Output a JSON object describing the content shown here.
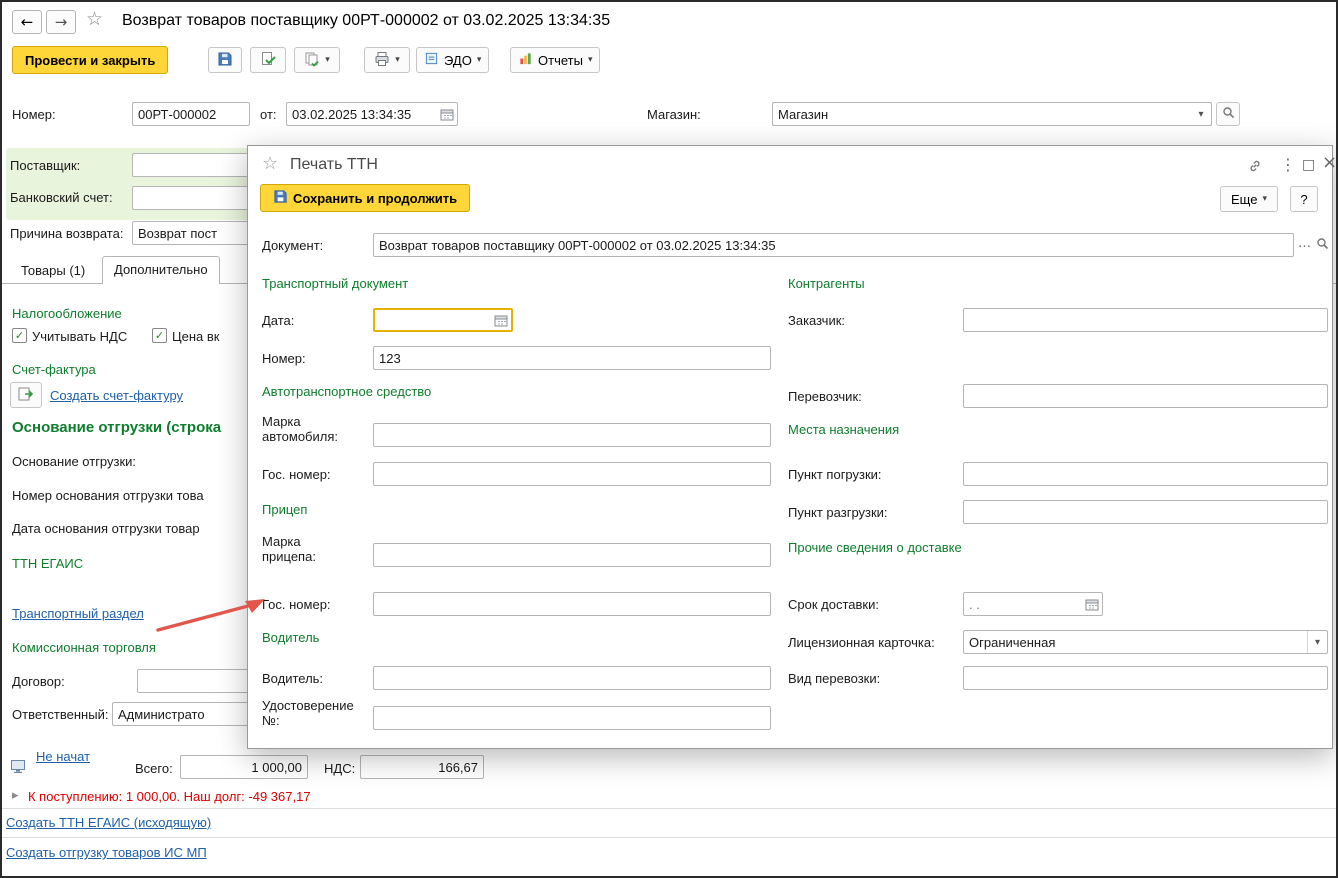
{
  "window": {
    "title": "Возврат товаров поставщику 00РТ-000002 от 03.02.2025 13:34:35",
    "toolbar": {
      "post_and_close": "Провести и закрыть",
      "edo_label": "ЭДО",
      "reports_label": "Отчеты"
    },
    "header_fields": {
      "number_label": "Номер:",
      "number_value": "00РТ-000002",
      "date_label": "от:",
      "date_value": "03.02.2025 13:34:35",
      "store_label": "Магазин:",
      "store_value": "Магазин",
      "supplier_label": "Поставщик:",
      "bank_account_label": "Банковский счет:",
      "reason_label": "Причина возврата:",
      "reason_value": "Возврат пост"
    },
    "tabs": {
      "goods": "Товары (1)",
      "additional": "Дополнительно"
    },
    "additional_tab": {
      "taxation_title": "Налогообложение",
      "vat_checkbox_label": "Учитывать НДС",
      "price_checkbox_label": "Цена вк",
      "invoice_title": "Счет-фактура",
      "create_invoice_link": "Создать счет-фактуру",
      "shipment_basis_heading": "Основание отгрузки (строка",
      "shipment_basis_label": "Основание отгрузки:",
      "shipment_basis_number_label": "Номер основания отгрузки това",
      "shipment_basis_date_label": "Дата основания отгрузки товар",
      "ttn_egais_title": "ТТН ЕГАИС",
      "transport_section_link": "Транспортный раздел",
      "commission_title": "Комиссионная торговля",
      "contract_label": "Договор:",
      "responsible_label": "Ответственный:",
      "responsible_value": "Администрато"
    },
    "footer": {
      "egais_status_link": "Не начат",
      "total_label": "Всего:",
      "total_value": "1 000,00",
      "vat_label": "НДС:",
      "vat_value": "166,67",
      "debt_warning": "К поступлению: 1 000,00. Наш долг: -49 367,17",
      "create_ttn_link": "Создать ТТН ЕГАИС (исходящую)",
      "create_shipment_link": "Создать отгрузку товаров ИС МП"
    }
  },
  "dialog": {
    "title": "Печать ТТН",
    "toolbar": {
      "save_continue": "Сохранить и продолжить",
      "more": "Еще",
      "help": "?"
    },
    "document": {
      "label": "Документ:",
      "value": "Возврат товаров поставщику 00РТ-000002 от 03.02.2025 13:34:35"
    },
    "transport_doc": {
      "title": "Транспортный документ",
      "date_label": "Дата:",
      "date_value": "",
      "number_label": "Номер:",
      "number_value": "123"
    },
    "vehicle": {
      "title": "Автотранспортное средство",
      "brand_label": "Марка автомобиля:",
      "number_label": "Гос. номер:"
    },
    "trailer": {
      "title": "Прицеп",
      "brand_label": "Марка прицепа:",
      "number_label": "Гос. номер:"
    },
    "driver": {
      "title": "Водитель",
      "name_label": "Водитель:",
      "license_label": "Удостоверение №:"
    },
    "counterparties": {
      "title": "Контрагенты",
      "customer_label": "Заказчик:",
      "carrier_label": "Перевозчик:"
    },
    "destinations": {
      "title": "Места назначения",
      "loading_label": "Пункт погрузки:",
      "unloading_label": "Пункт разгрузки:"
    },
    "delivery": {
      "title": "Прочие сведения о доставке",
      "term_label": "Срок доставки:",
      "term_placeholder": ". .",
      "license_card_label": "Лицензионная карточка:",
      "license_card_value": "Ограниченная",
      "transport_kind_label": "Вид перевозки:"
    }
  },
  "icons": {
    "back": "←",
    "forward": "→",
    "favorite": "☆",
    "dropdown": "▾",
    "dots": "⋮",
    "maximize": "□",
    "close": "×",
    "check": "✓",
    "ellipsis": "…",
    "expander": "▸"
  },
  "colors": {
    "accent_yellow": "#ffd639",
    "section_green": "#0e7d2d",
    "link_blue": "#2060a8",
    "warning_red": "#dd0000",
    "focus_orange": "#e8b000"
  }
}
